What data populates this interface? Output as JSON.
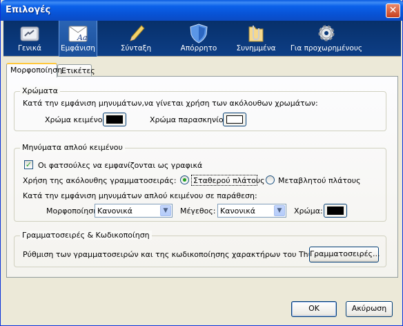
{
  "window": {
    "title": "Επιλογές",
    "close_symbol": "✕"
  },
  "toolbar": {
    "items": [
      {
        "label": "Γενικά",
        "icon": "general-icon"
      },
      {
        "label": "Εμφάνιση",
        "icon": "display-icon",
        "selected": true
      },
      {
        "label": "Σύνταξη",
        "icon": "pencil-icon"
      },
      {
        "label": "Απόρρητο",
        "icon": "shield-icon"
      },
      {
        "label": "Συνημμένα",
        "icon": "paperclip-folder-icon"
      },
      {
        "label": "Για προχωρημένους",
        "icon": "gear-icon"
      }
    ]
  },
  "tabs": [
    {
      "label": "Μορφοποίηση",
      "active": true
    },
    {
      "label": "Ετικέτες",
      "active": false
    }
  ],
  "colors_group": {
    "title": "Χρώματα",
    "description": "Κατά την εμφάνιση μηνυμάτων,να γίνεται χρήση των ακόλουθων χρωμάτων:",
    "text_color_label": "Χρώμα κειμένου:",
    "background_color_label": "Χρώμα παρασκηνίου:",
    "text_color": "#000000",
    "background_color": "#ffffff"
  },
  "plain_text_group": {
    "title": "Μηνύματα απλού κειμένου",
    "emoticons_label": "Οι φατσούλες να εμφανίζονται ως γραφικά",
    "emoticons_checked": true,
    "font_usage_label": "Χρήση της ακόλουθης γραμματοσειράς:",
    "fixed_width_label": "Σταθερού πλάτους",
    "variable_width_label": "Μεταβλητού πλάτους",
    "fixed_width_selected": true,
    "quoted_label": "Κατά την εμφάνιση μηνυμάτων απλού κειμένου σε παράθεση:",
    "style_label": "Μορφοποίηση:",
    "style_value": "Κανονικά",
    "size_label": "Μέγεθος:",
    "size_value": "Κανονικά",
    "color_label": "Χρώμα:",
    "quoted_color": "#000000"
  },
  "fonts_group": {
    "title": "Γραμματοσειρές & Κωδικοποίηση",
    "description": "Ρύθμιση των γραμματοσειρών και της κωδικοποίησης χαρακτήρων του Thunderbird",
    "fonts_button": "Γραμματοσειρές..."
  },
  "footer": {
    "ok": "OK",
    "cancel": "Ακύρωση"
  },
  "colors": {
    "title_bar": "#0b61ea",
    "toolbar": "#0b3a7a",
    "dialog": "#ece9d8",
    "check": "#21a121"
  }
}
